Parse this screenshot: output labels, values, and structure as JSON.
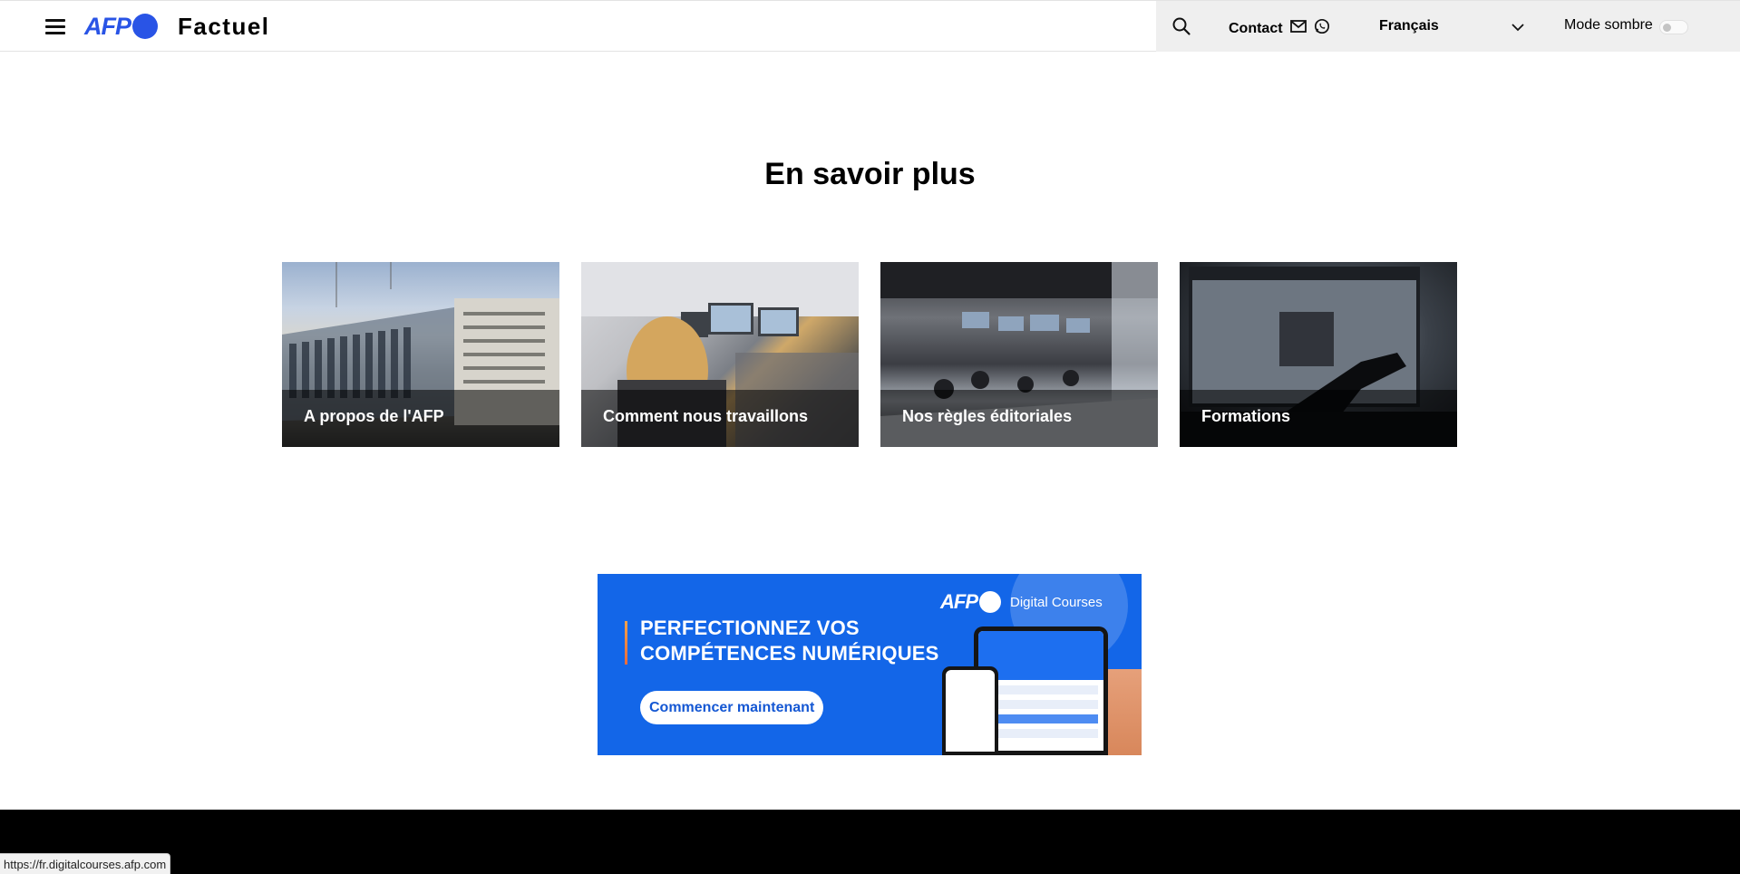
{
  "header": {
    "logo_text": "AFP",
    "site_name": "Factuel",
    "contact_label": "Contact",
    "language_selected": "Français",
    "dark_mode_label": "Mode sombre",
    "dark_mode_enabled": false,
    "brand_color": "#2954e6"
  },
  "main": {
    "section_title": "En savoir plus",
    "cards": [
      {
        "label": "A propos de l'AFP"
      },
      {
        "label": "Comment nous travaillons"
      },
      {
        "label": "Nos règles éditoriales"
      },
      {
        "label": "Formations"
      }
    ]
  },
  "banner": {
    "headline_line1": "PERFECTIONNEZ VOS",
    "headline_line2": "COMPÉTENCES NUMÉRIQUES",
    "cta_label": "Commencer maintenant",
    "brand_logo": "AFP",
    "brand_sub": "Digital Courses",
    "background_color": "#1366e8"
  },
  "status_bar": {
    "url": "https://fr.digitalcourses.afp.com"
  }
}
